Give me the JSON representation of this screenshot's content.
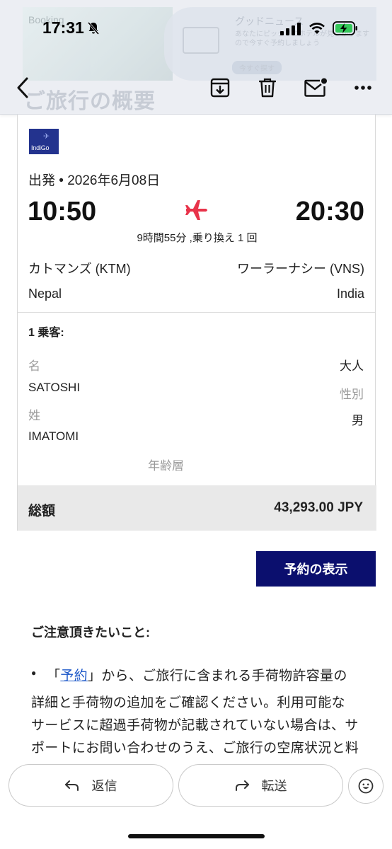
{
  "status_bar": {
    "time": "17:31"
  },
  "background_ad": {
    "left_brand": "Booking",
    "right_title": "グッドニュース",
    "right_subtitle": "あなたにピッタリのホテルが見つかりますので今すぐ予約しましょう",
    "right_button": "今すぐ探す"
  },
  "ghost_title": "ご旅行の概要",
  "toolbar": {
    "icons": [
      "back-icon",
      "archive-icon",
      "trash-icon",
      "mail-unread-icon",
      "more-icon"
    ]
  },
  "flight": {
    "airline_logo_text": "IndiGo",
    "departure_label": "出発 • 2026年6月08日",
    "departure_time": "10:50",
    "arrival_time": "20:30",
    "duration": "9時間55分 ,乗り換え 1 回",
    "origin_city": "カトマンズ (KTM)",
    "destination_city": "ワーラーナシー (VNS)",
    "origin_country": "Nepal",
    "destination_country": "India",
    "plane_color": "#e8334a"
  },
  "passengers": {
    "count_label": "1 乗客:",
    "first_name_label": "名",
    "first_name": "SATOSHI",
    "last_name_label": "姓",
    "last_name": "IMATOMI",
    "passenger_type": "大人",
    "gender_label": "性別",
    "gender": "男",
    "age_group_label": "年齢層"
  },
  "total": {
    "label": "総額",
    "amount": "43,293.00 JPY"
  },
  "view_booking_button": "予約の表示",
  "notice": {
    "heading": "ご注意頂きたいこと:",
    "bullet": "●",
    "line1_prefix": "「",
    "line1_link": "予約",
    "line1_suffix": "」から、ご旅行に含まれる手荷物許容量の",
    "line2": "詳細と手荷物の追加をご確認ください。利用可能な",
    "line3": "サービスに超過手荷物が記載されていない場合は、サ",
    "line4": "ポートにお問い合わせのうえ、ご旅行の空席状況と料"
  },
  "bottom_bar": {
    "reply": "返信",
    "forward": "転送"
  },
  "colors": {
    "navy_button": "#0b0f6e",
    "link": "#1a56c8",
    "airline_blue": "#23338e"
  }
}
